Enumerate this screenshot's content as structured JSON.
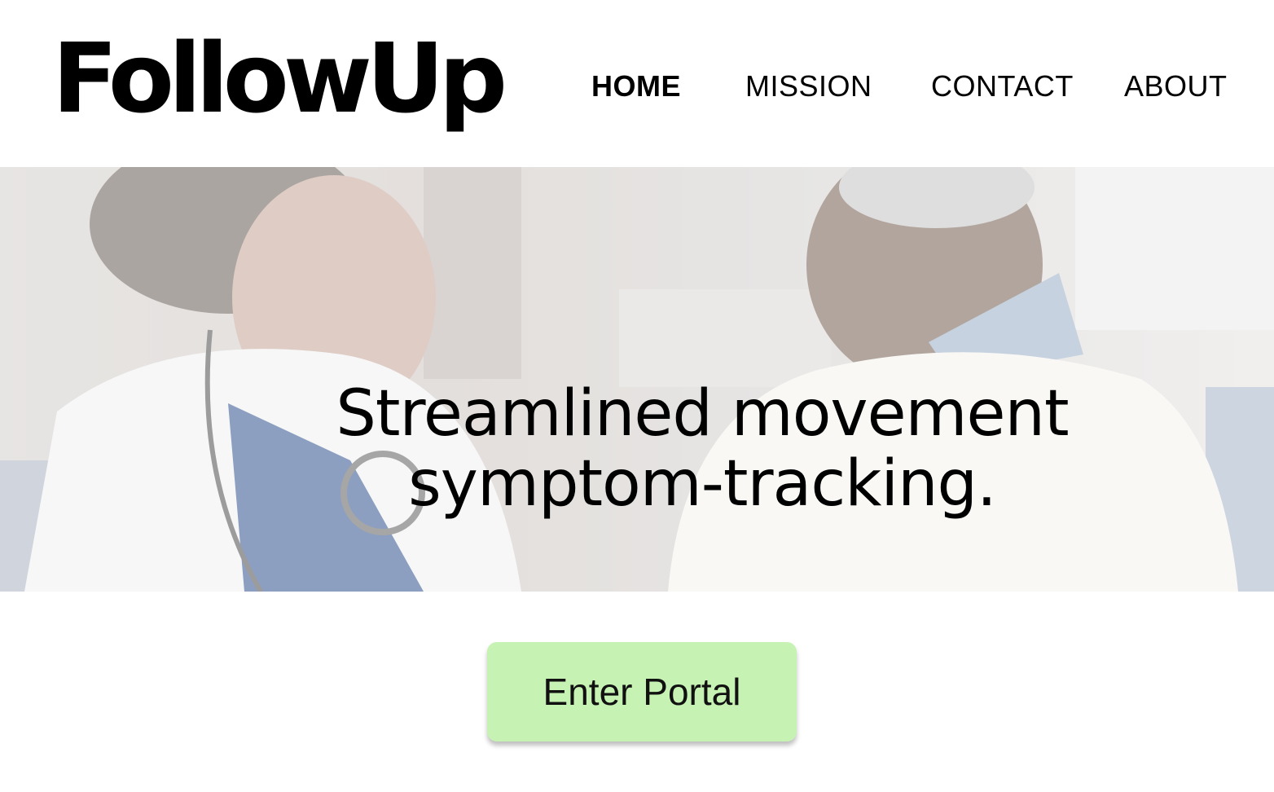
{
  "brand": {
    "name": "FollowUp"
  },
  "nav": {
    "items": [
      {
        "label": "HOME",
        "active": true
      },
      {
        "label": "MISSION"
      },
      {
        "label": "CONTACT"
      },
      {
        "label": "ABOUT"
      }
    ]
  },
  "hero": {
    "headline_line1": "Streamlined movement",
    "headline_line2": "symptom-tracking.",
    "image": "doctor-and-patient-smiling-photo"
  },
  "cta": {
    "label": "Enter Portal",
    "color": "#c6f2b3"
  }
}
